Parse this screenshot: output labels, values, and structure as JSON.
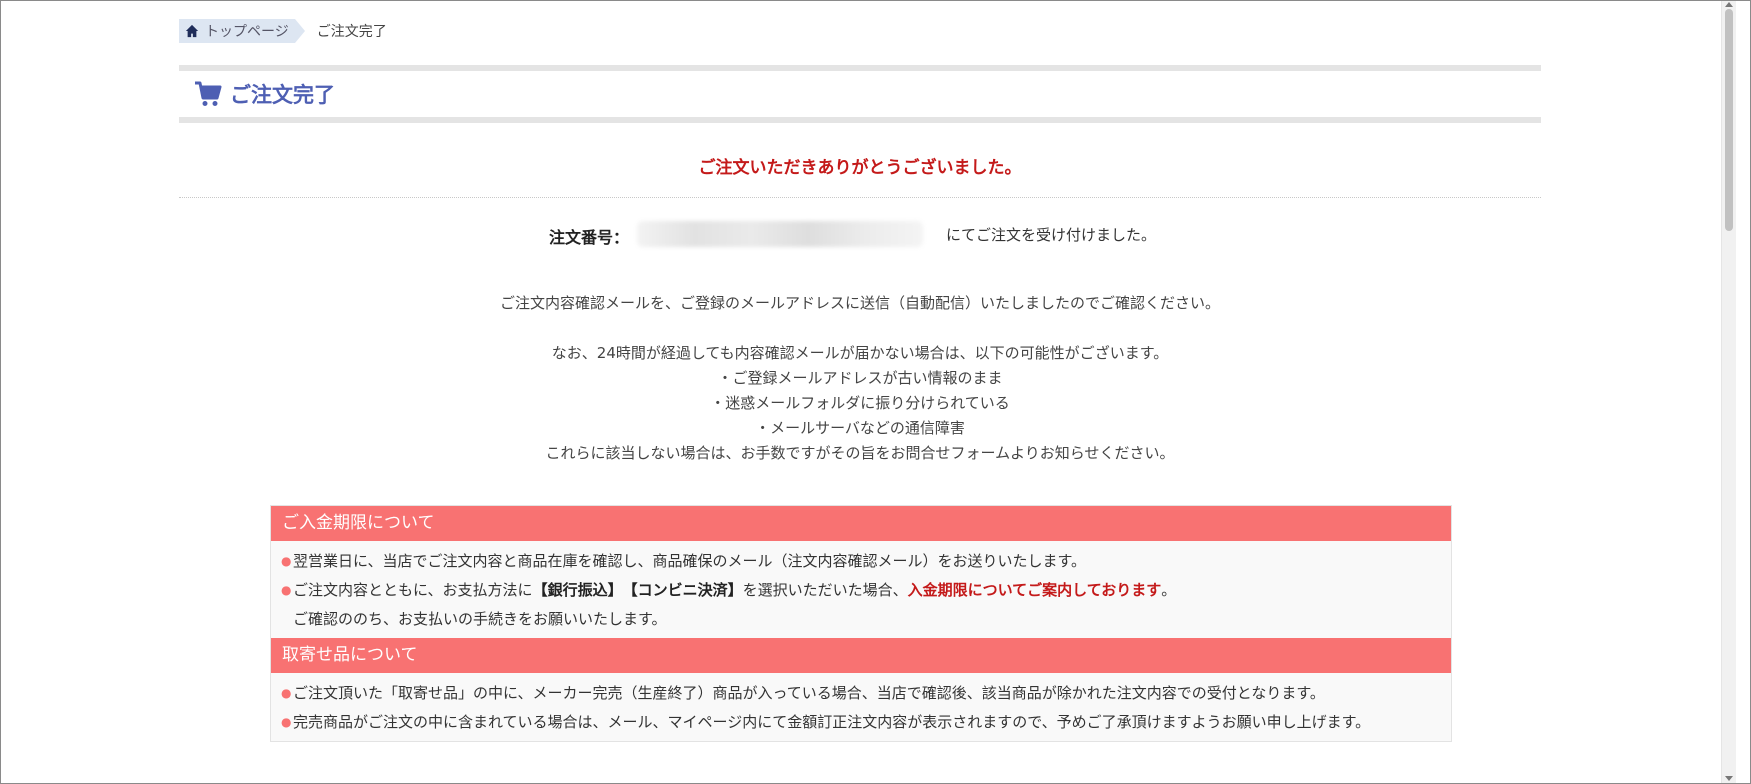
{
  "breadcrumb": {
    "home_label": "トップページ",
    "current_label": "ご注文完了"
  },
  "header": {
    "title": "ご注文完了"
  },
  "thanks_message": "ご注文いただきありがとうございました。",
  "order": {
    "label": "注文番号：",
    "suffix": "にてご注文を受け付けました。"
  },
  "confirm_message": "ご注文内容確認メールを、ご登録のメールアドレスに送信（自動配信）いたしましたのでご確認ください。",
  "notice_lines": {
    "intro": "なお、24時間が経過しても内容確認メールが届かない場合は、以下の可能性がございます。",
    "reason1": "・ご登録メールアドレスが古い情報のまま",
    "reason2": "・迷惑メールフォルダに振り分けられている",
    "reason3": "・メールサーバなどの通信障害",
    "outro": "これらに該当しない場合は、お手数ですがその旨をお問合せフォームよりお知らせください。"
  },
  "payment_section": {
    "title": "ご入金期限について",
    "item1": "翌営業日に、当店でご注文内容と商品在庫を確認し、商品確保のメール（注文内容確認メール）をお送りいたします。",
    "item2_pre": "ご注文内容とともに、お支払方法に",
    "item2_bank": "【銀行振込】",
    "item2_conv": "【コンビニ決済】",
    "item2_mid": "を選択いただいた場合、",
    "item2_red": "入金期限についてご案内しております",
    "item2_end": "。",
    "item2_cont": "ご確認ののち、お支払いの手続きをお願いいたします。"
  },
  "order_items_section": {
    "title": "取寄せ品について",
    "item1": "ご注文頂いた「取寄せ品」の中に、メーカー完売（生産終了）商品が入っている場合、当店で確認後、該当商品が除かれた注文内容での受付となります。",
    "item2": "完売商品がご注文の中に含まれている場合は、メール、マイページ内にて金額訂正注文内容が表示されますので、予めご了承頂けますようお願い申し上げます。"
  },
  "colors": {
    "accent_red": "#c41a1a",
    "section_header": "#f87272",
    "title_blue": "#4e5fb3",
    "breadcrumb_bg": "#dde6f2"
  },
  "icons": {
    "home": "home-icon",
    "cart": "cart-icon"
  }
}
